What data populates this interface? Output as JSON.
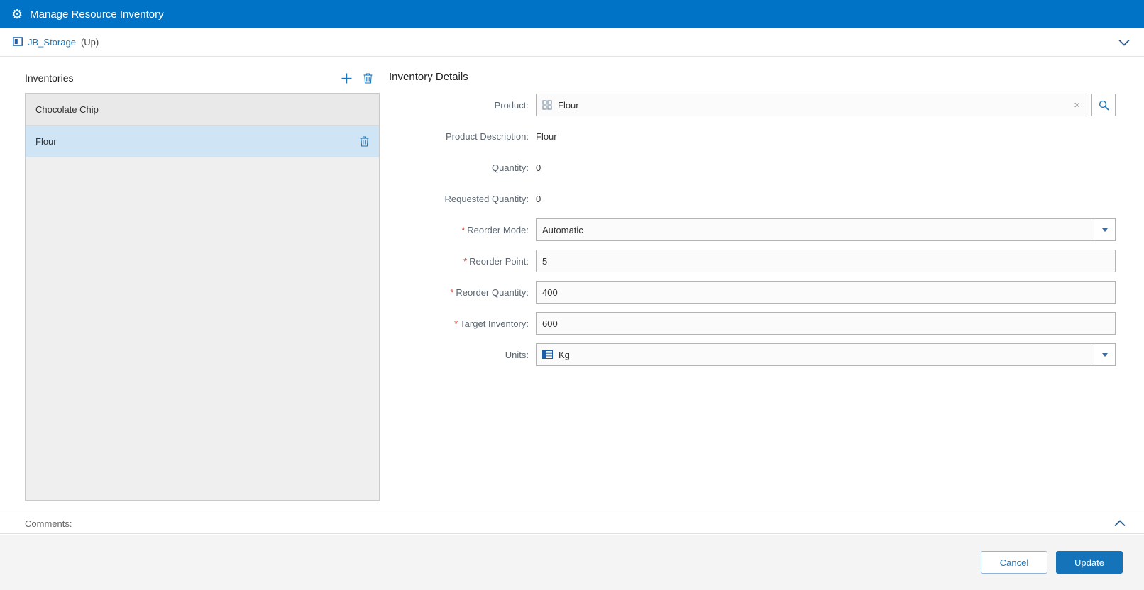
{
  "header": {
    "title": "Manage Resource Inventory"
  },
  "breadcrumb": {
    "link": "JB_Storage",
    "suffix": "(Up)"
  },
  "inventories": {
    "title": "Inventories",
    "items": [
      {
        "label": "Chocolate Chip",
        "selected": false
      },
      {
        "label": "Flour",
        "selected": true
      }
    ]
  },
  "details": {
    "title": "Inventory Details",
    "fields": {
      "product": {
        "label": "Product:",
        "value": "Flour",
        "required": false
      },
      "product_description": {
        "label": "Product Description:",
        "value": "Flour"
      },
      "quantity": {
        "label": "Quantity:",
        "value": "0"
      },
      "requested_quantity": {
        "label": "Requested Quantity:",
        "value": "0"
      },
      "reorder_mode": {
        "label": "Reorder Mode:",
        "value": "Automatic",
        "required": true
      },
      "reorder_point": {
        "label": "Reorder Point:",
        "value": "5",
        "required": true
      },
      "reorder_quantity": {
        "label": "Reorder Quantity:",
        "value": "400",
        "required": true
      },
      "target_inventory": {
        "label": "Target Inventory:",
        "value": "600",
        "required": true
      },
      "units": {
        "label": "Units:",
        "value": "Kg",
        "required": false
      }
    }
  },
  "comments": {
    "label": "Comments:"
  },
  "footer": {
    "cancel_label": "Cancel",
    "update_label": "Update"
  },
  "icons": {
    "gear": "⚙",
    "clear": "×",
    "required": "*"
  },
  "colors": {
    "header_bg": "#0173c6",
    "accent_blue": "#1a75bb",
    "selected_row": "#cfe4f4",
    "update_button_bg": "#1573ba"
  }
}
